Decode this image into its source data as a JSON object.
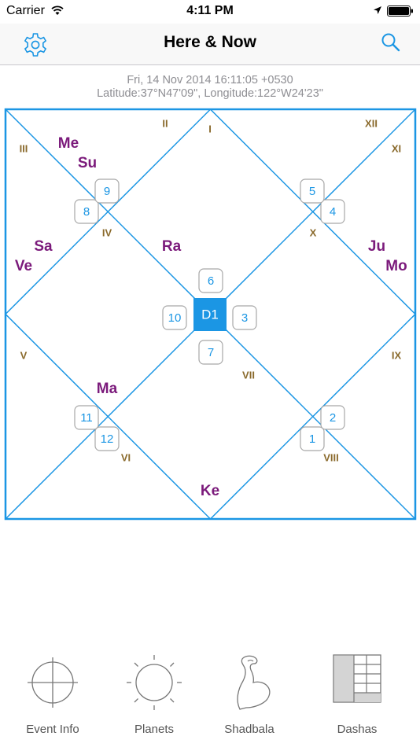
{
  "status_bar": {
    "carrier": "Carrier",
    "time": "4:11 PM"
  },
  "nav": {
    "title": "Here & Now"
  },
  "info": {
    "datetime": "Fri, 14 Nov 2014 16:11:05 +0530",
    "location": "Latitude:37°N47'09\", Longitude:122°W24'23\""
  },
  "colors": {
    "accent": "#1b96e4",
    "house": "#8a6a2c",
    "planet": "#7b1a7b"
  },
  "chart": {
    "center_label": "D1",
    "houses": [
      "I",
      "II",
      "III",
      "IV",
      "V",
      "VI",
      "VII",
      "VIII",
      "IX",
      "X",
      "XI",
      "XII"
    ],
    "signs": [
      "1",
      "2",
      "3",
      "4",
      "5",
      "6",
      "7",
      "8",
      "9",
      "10",
      "11",
      "12"
    ],
    "planets": [
      "Me",
      "Su",
      "Sa",
      "Ve",
      "Ra",
      "Ju",
      "Mo",
      "Ma",
      "Ke"
    ]
  },
  "tabs": [
    {
      "label": "Event Info",
      "icon": "crosshair-icon"
    },
    {
      "label": "Planets",
      "icon": "sun-icon"
    },
    {
      "label": "Shadbala",
      "icon": "strength-arm-icon"
    },
    {
      "label": "Dashas",
      "icon": "table-icon"
    }
  ]
}
